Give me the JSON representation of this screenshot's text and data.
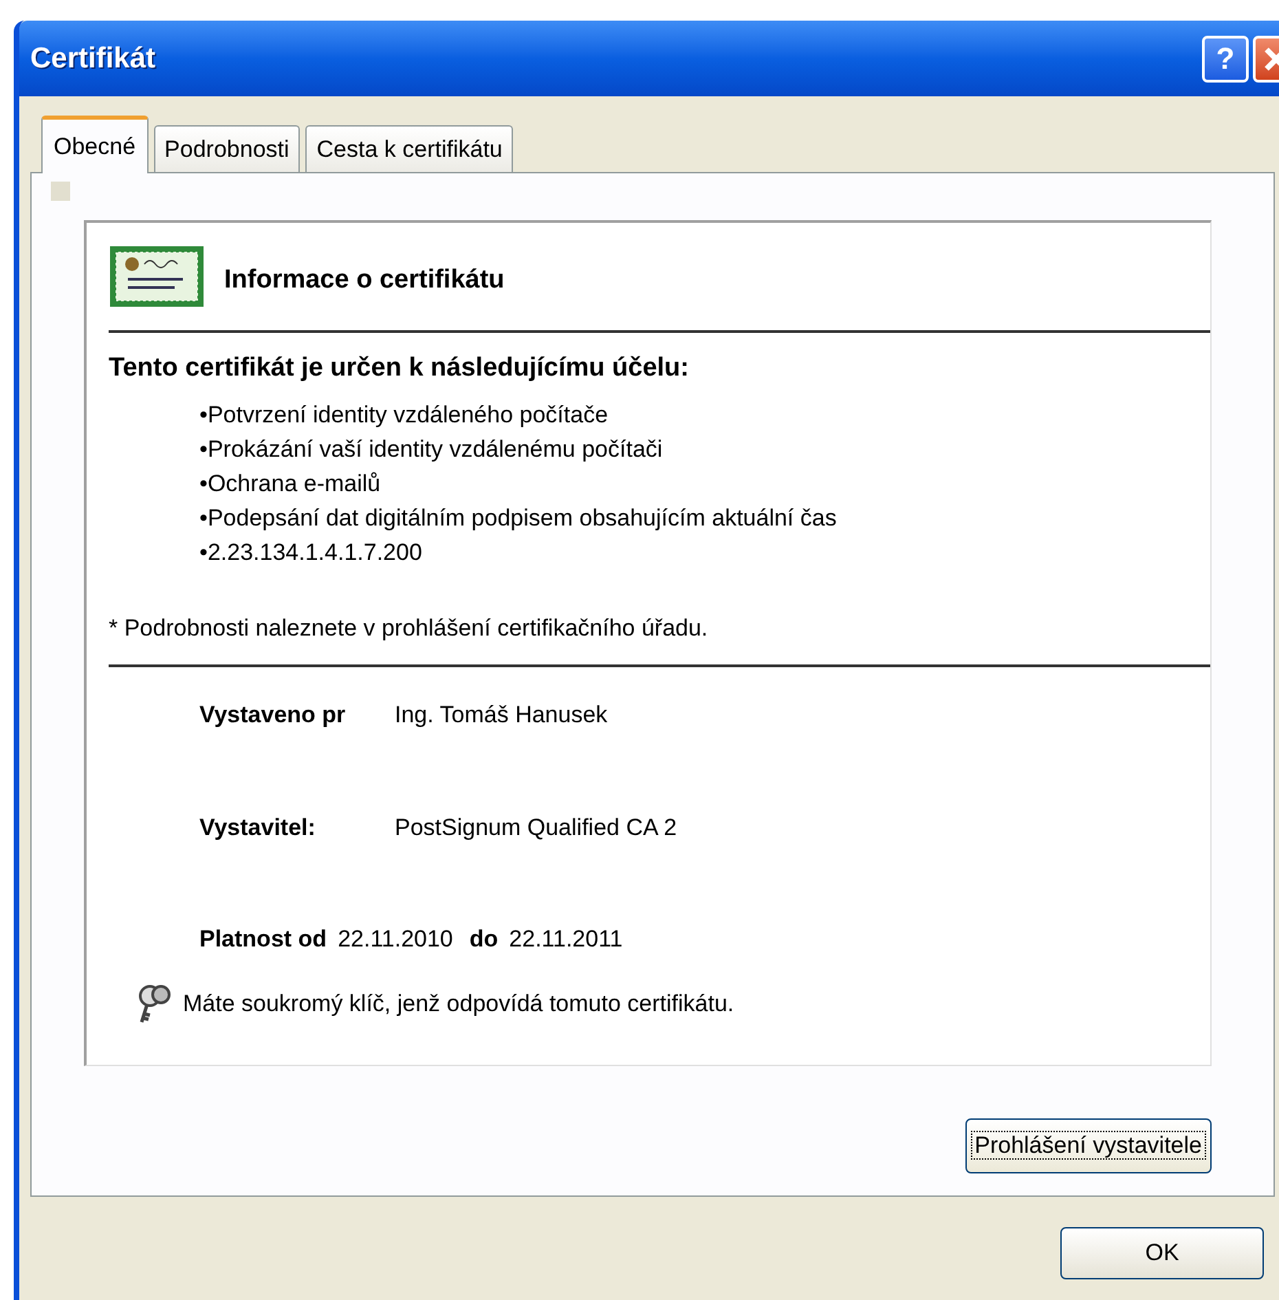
{
  "window": {
    "title": "Certifikát",
    "help_button": "?"
  },
  "tabs": [
    {
      "label": "Obecné",
      "selected": true
    },
    {
      "label": "Podrobnosti",
      "selected": false
    },
    {
      "label": "Cesta k certifikátu",
      "selected": false
    }
  ],
  "info": {
    "heading": "Informace o certifikátu",
    "purpose_heading": "Tento certifikát je určen k následujícímu účelu:",
    "purposes": [
      "•Potvrzení identity vzdáleného počítače",
      "•Prokázání vaší identity vzdálenému počítači",
      "•Ochrana e-mailů",
      "•Podepsání dat digitálním podpisem obsahujícím aktuální čas",
      "•2.23.134.1.4.1.7.200"
    ],
    "footnote": "* Podrobnosti naleznete v prohlášení certifikačního úřadu.",
    "issued_to_label": "Vystaveno pr",
    "issued_to": "Ing. Tomáš Hanusek",
    "issuer_label": "Vystavitel:",
    "issuer": "PostSignum Qualified CA 2",
    "valid_from_label": "Platnost od",
    "valid_from": "22.11.2010",
    "valid_to_label": "do",
    "valid_to": "22.11.2011",
    "private_key_note": "Máte soukromý klíč, jenž odpovídá tomuto certifikátu."
  },
  "issuer_statement_button": {
    "label": "Prohlášení vystavitele",
    "focused": true
  },
  "ok_button": {
    "label": "OK"
  }
}
